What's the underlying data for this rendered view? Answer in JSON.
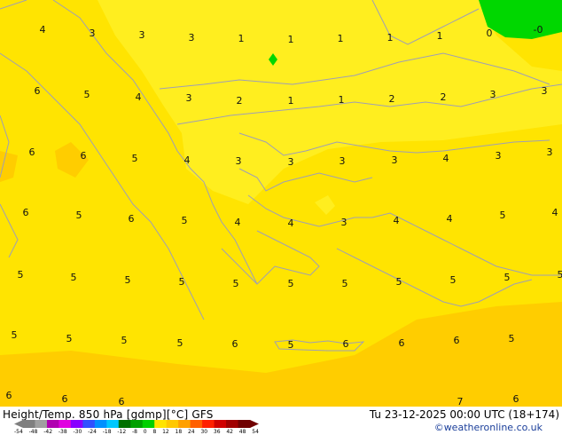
{
  "map": {
    "colors": {
      "background": "#ffe401",
      "light_zone": "#ffee1f",
      "orange_zone": "#ffcd00",
      "green_zone": "#00d700",
      "coast": "#9f9fb4"
    },
    "labels": [
      {
        "value": "4"
      },
      {
        "value": "3"
      },
      {
        "value": "3"
      },
      {
        "value": "3"
      },
      {
        "value": "1"
      },
      {
        "value": "1"
      },
      {
        "value": "1"
      },
      {
        "value": "1"
      },
      {
        "value": "1"
      },
      {
        "value": "0"
      },
      {
        "value": "-0"
      },
      {
        "value": "6"
      },
      {
        "value": "5"
      },
      {
        "value": "4"
      },
      {
        "value": "3"
      },
      {
        "value": "2"
      },
      {
        "value": "1"
      },
      {
        "value": "1"
      },
      {
        "value": "2"
      },
      {
        "value": "2"
      },
      {
        "value": "3"
      },
      {
        "value": "3"
      },
      {
        "value": "6"
      },
      {
        "value": "6"
      },
      {
        "value": "5"
      },
      {
        "value": "4"
      },
      {
        "value": "3"
      },
      {
        "value": "3"
      },
      {
        "value": "3"
      },
      {
        "value": "3"
      },
      {
        "value": "4"
      },
      {
        "value": "3"
      },
      {
        "value": "3"
      },
      {
        "value": "6"
      },
      {
        "value": "5"
      },
      {
        "value": "6"
      },
      {
        "value": "5"
      },
      {
        "value": "4"
      },
      {
        "value": "4"
      },
      {
        "value": "3"
      },
      {
        "value": "4"
      },
      {
        "value": "4"
      },
      {
        "value": "5"
      },
      {
        "value": "4"
      },
      {
        "value": "5"
      },
      {
        "value": "5"
      },
      {
        "value": "5"
      },
      {
        "value": "5"
      },
      {
        "value": "5"
      },
      {
        "value": "5"
      },
      {
        "value": "5"
      },
      {
        "value": "5"
      },
      {
        "value": "5"
      },
      {
        "value": "5"
      },
      {
        "value": "5"
      },
      {
        "value": "5"
      },
      {
        "value": "5"
      },
      {
        "value": "5"
      },
      {
        "value": "5"
      },
      {
        "value": "6"
      },
      {
        "value": "5"
      },
      {
        "value": "6"
      },
      {
        "value": "6"
      },
      {
        "value": "6"
      },
      {
        "value": "5"
      },
      {
        "value": "6"
      },
      {
        "value": "6"
      },
      {
        "value": "6"
      },
      {
        "value": "7"
      },
      {
        "value": "6"
      }
    ]
  },
  "footer": {
    "title_left": "Height/Temp. 850 hPa [gdmp][°C] GFS",
    "title_right": "Tu 23-12-2025 00:00 UTC (18+174)",
    "credit": "©weatheronline.co.uk",
    "colorbar_ticks": [
      "-54",
      "-48",
      "-42",
      "-38",
      "-30",
      "-24",
      "-18",
      "-12",
      "-8",
      "0",
      "8",
      "12",
      "18",
      "24",
      "30",
      "36",
      "42",
      "48",
      "54"
    ],
    "colorbar_colors": [
      "#7f7f7f",
      "#a0a0a0",
      "#b000b0",
      "#e000e0",
      "#8800ff",
      "#3050ff",
      "#0090ff",
      "#00c8ff",
      "#007000",
      "#00a000",
      "#00d000",
      "#ffe400",
      "#ffc800",
      "#ffa000",
      "#ff6000",
      "#ff2000",
      "#d00000",
      "#a00000",
      "#700000"
    ]
  }
}
